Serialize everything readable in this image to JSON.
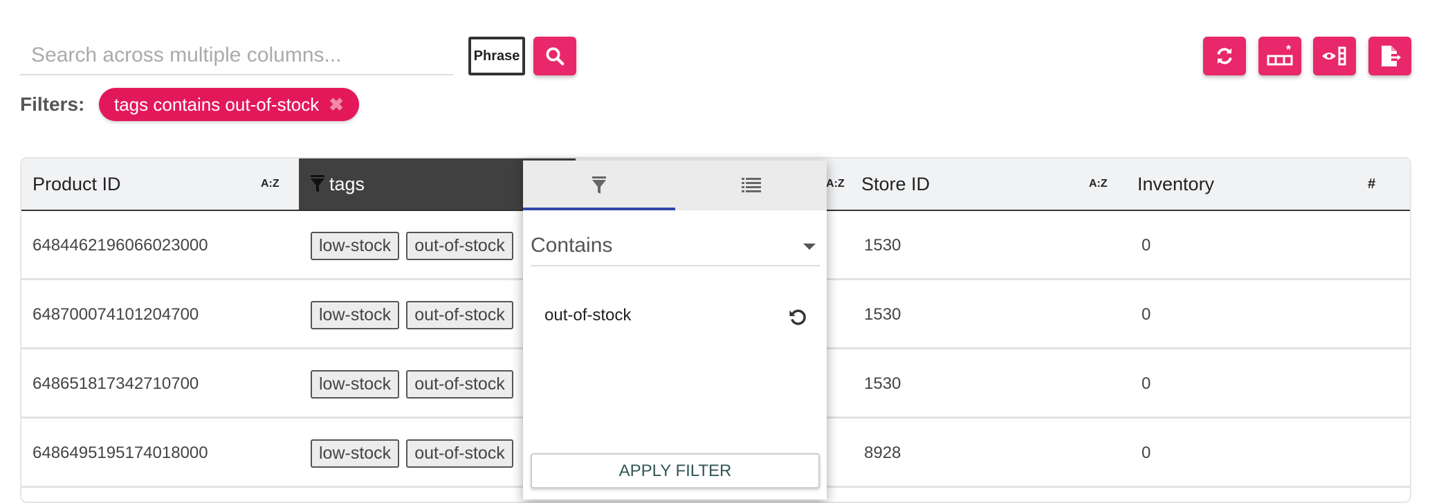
{
  "search": {
    "placeholder": "Search across multiple columns...",
    "phrase_label": "Phrase",
    "search_icon": "search-icon"
  },
  "toolbar": {
    "icons": [
      "refresh-icon",
      "add-row-icon",
      "column-visibility-icon",
      "export-icon"
    ],
    "accent": "#e8286a"
  },
  "filters": {
    "label": "Filters:",
    "chips": [
      {
        "label": "tags contains out-of-stock"
      }
    ]
  },
  "table": {
    "columns": [
      {
        "label": "Product ID",
        "sort": "A:Z"
      },
      {
        "label": "tags",
        "filtered": true
      },
      {
        "label": "",
        "sort": "A:Z"
      },
      {
        "label": "Store ID",
        "sort": "A:Z"
      },
      {
        "label": "Inventory",
        "sort": "#"
      }
    ],
    "rows": [
      {
        "product_id": "6484462196066023000",
        "tags": [
          "low-stock",
          "out-of-stock"
        ],
        "store_id": "1530",
        "inventory": "0"
      },
      {
        "product_id": "648700074101204700",
        "tags": [
          "low-stock",
          "out-of-stock"
        ],
        "store_id": "1530",
        "inventory": "0"
      },
      {
        "product_id": "648651817342710700",
        "tags": [
          "low-stock",
          "out-of-stock"
        ],
        "store_id": "1530",
        "inventory": "0"
      },
      {
        "product_id": "6486495195174018000",
        "tags": [
          "low-stock",
          "out-of-stock"
        ],
        "store_id": "8928",
        "inventory": "0"
      }
    ]
  },
  "filter_popup": {
    "tabs": [
      "filter-icon",
      "list-icon"
    ],
    "operator": "Contains",
    "value": "out-of-stock",
    "apply_label": "APPLY FILTER"
  }
}
